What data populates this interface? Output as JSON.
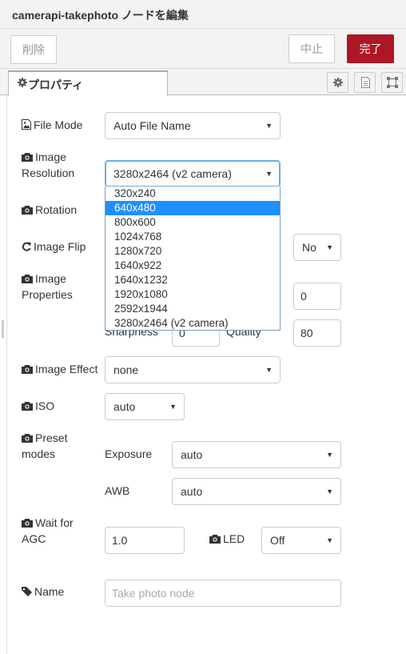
{
  "header": {
    "title": "camerapi-takephoto ノードを編集"
  },
  "buttons": {
    "delete": "削除",
    "cancel": "中止",
    "done": "完了"
  },
  "tab": {
    "label": "プロパティ"
  },
  "fields": {
    "file_mode": {
      "label": "File Mode",
      "value": "Auto File Name"
    },
    "resolution": {
      "label_line1": "Image",
      "label_line2": "Resolution",
      "value": "3280x2464 (v2 camera)",
      "options": [
        "320x240",
        "640x480",
        "800x600",
        "1024x768",
        "1280x720",
        "1640x922",
        "1640x1232",
        "1920x1080",
        "2592x1944",
        "3280x2464 (v2 camera)"
      ],
      "highlighted": "640x480"
    },
    "rotation": {
      "label": "Rotation"
    },
    "flip": {
      "label": "Image Flip",
      "vflip_value": "No"
    },
    "properties": {
      "label_line1": "Image",
      "label_line2": "Properties",
      "top_right_value": "0",
      "sharpness_label": "Sharpness",
      "sharpness_value": "0",
      "quality_label": "Quality",
      "quality_value": "80"
    },
    "effect": {
      "label": "Image Effect",
      "value": "none"
    },
    "iso": {
      "label": "ISO",
      "value": "auto"
    },
    "preset": {
      "label_line1": "Preset",
      "label_line2": "modes",
      "exposure_label": "Exposure",
      "exposure_value": "auto",
      "awb_label": "AWB",
      "awb_value": "auto"
    },
    "agc": {
      "label_line1": "Wait for",
      "label_line2": "AGC",
      "value": "1.0",
      "led_label": "LED",
      "led_value": "Off"
    },
    "name": {
      "label": "Name",
      "placeholder": "Take photo node"
    }
  },
  "colors": {
    "accent": "#ad1625",
    "highlight": "#1e90ff"
  }
}
